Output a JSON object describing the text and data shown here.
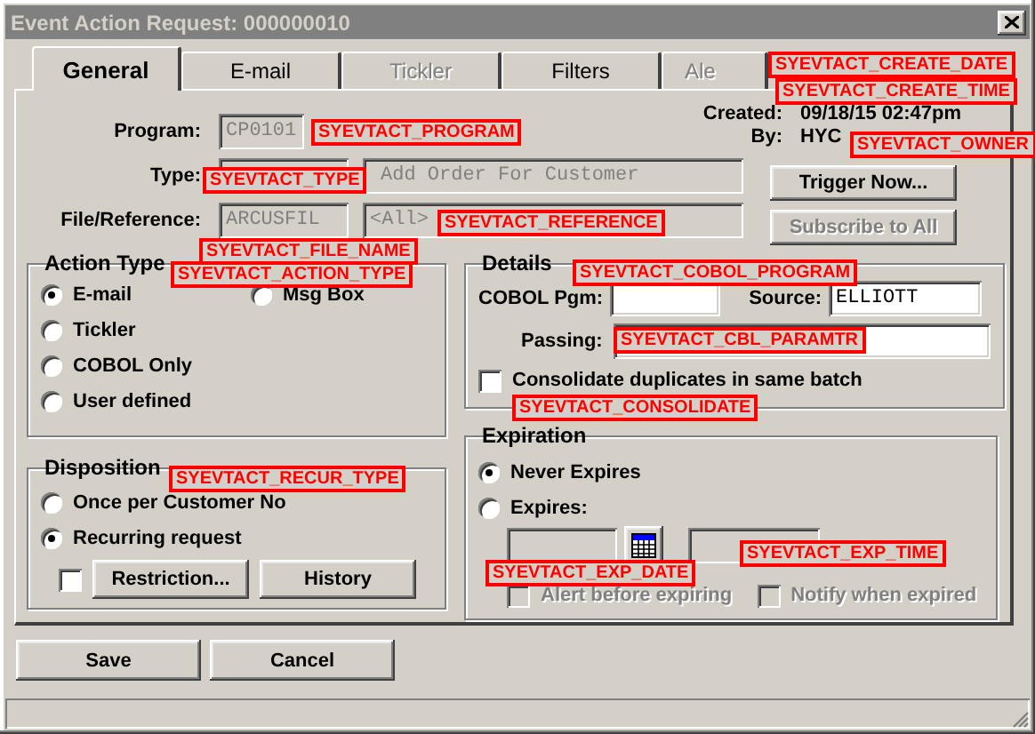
{
  "window": {
    "title": "Event Action Request: 000000010"
  },
  "tabs": [
    {
      "label": "General",
      "selected": true,
      "disabled": false
    },
    {
      "label": "E-mail",
      "selected": false,
      "disabled": false
    },
    {
      "label": "Tickler",
      "selected": false,
      "disabled": true
    },
    {
      "label": "Filters",
      "selected": false,
      "disabled": false
    },
    {
      "label": "Ale",
      "selected": false,
      "disabled": true
    }
  ],
  "header": {
    "program": {
      "label": "Program:",
      "value": "CP0101"
    },
    "type": {
      "label": "Type:",
      "description": "Add Order For Customer"
    },
    "file_reference": {
      "label": "File/Reference:",
      "file": "ARCUSFIL",
      "reference": "<All>"
    },
    "created": {
      "label": "Created:",
      "value": "09/18/15 02:47pm"
    },
    "by": {
      "label": "By:",
      "value": "HYC"
    },
    "buttons": [
      {
        "label": "Trigger Now...",
        "disabled": false
      },
      {
        "label": "Subscribe to All",
        "disabled": true
      }
    ]
  },
  "action_type": {
    "title": "Action Type",
    "options": [
      {
        "label": "E-mail",
        "selected": true
      },
      {
        "label": "Msg Box",
        "selected": false
      },
      {
        "label": "Tickler",
        "selected": false
      },
      {
        "label": "COBOL Only",
        "selected": false
      },
      {
        "label": "User defined",
        "selected": false
      }
    ]
  },
  "disposition": {
    "title": "Disposition",
    "options": [
      {
        "label": "Once per Customer No",
        "selected": false
      },
      {
        "label": "Recurring request",
        "selected": true
      }
    ],
    "restriction": {
      "checked": false
    },
    "buttons": [
      "Restriction...",
      "History"
    ]
  },
  "details": {
    "title": "Details",
    "cobol_pgm": {
      "label": "COBOL Pgm:"
    },
    "source": {
      "label": "Source:",
      "value": "ELLIOTT"
    },
    "passing": {
      "label": "Passing:"
    },
    "consolidate": {
      "label": "Consolidate duplicates in same batch",
      "checked": false
    }
  },
  "expiration": {
    "title": "Expiration",
    "options": [
      {
        "label": "Never Expires",
        "selected": true
      },
      {
        "label": "Expires:",
        "selected": false
      }
    ],
    "alert": {
      "label": "Alert before expiring",
      "checked": false,
      "disabled": true
    },
    "notify": {
      "label": "Notify when expired",
      "checked": false,
      "disabled": true
    }
  },
  "footer_buttons": [
    "Save",
    "Cancel"
  ],
  "annotations": [
    "SYEVTACT_CREATE_DATE",
    "SYEVTACT_CREATE_TIME",
    "SYEVTACT_PROGRAM",
    "SYEVTACT_OWNER",
    "SYEVTACT_TYPE",
    "SYEVTACT_REFERENCE",
    "SYEVTACT_FILE_NAME",
    "SYEVTACT_ACTION_TYPE",
    "SYEVTACT_COBOL_PROGRAM",
    "SYEVTACT_CBL_PARAMTR",
    "SYEVTACT_CONSOLIDATE",
    "SYEVTACT_RECUR_TYPE",
    "SYEVTACT_EXP_DATE",
    "SYEVTACT_EXP_TIME"
  ]
}
